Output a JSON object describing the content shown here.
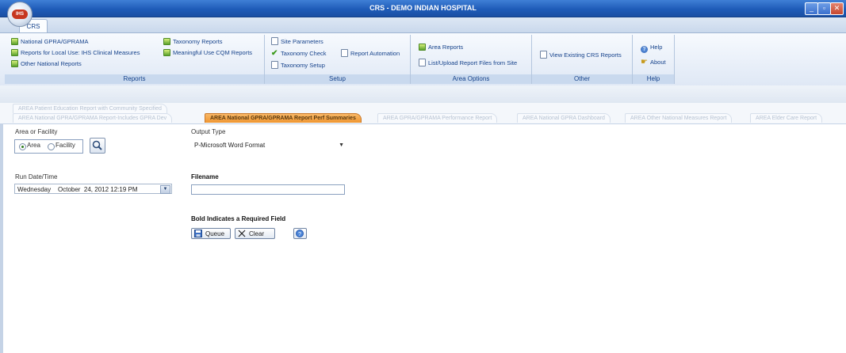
{
  "window": {
    "title": "CRS - DEMO INDIAN HOSPITAL",
    "orb_text": "IHS"
  },
  "ribbon_tab": "CRS",
  "ribbon": {
    "reports": {
      "label": "Reports",
      "items": [
        "National GPRA/GPRAMA",
        "Reports for Local Use: IHS Clinical Measures",
        "Other National Reports",
        "Taxonomy Reports",
        "Meaningful Use CQM Reports"
      ]
    },
    "setup": {
      "label": "Setup",
      "items": [
        "Site Parameters",
        "Taxonomy Check",
        "Report Automation",
        "Taxonomy Setup"
      ]
    },
    "area_options": {
      "label": "Area Options",
      "items": [
        "Area Reports",
        "List/Upload Report Files from Site"
      ]
    },
    "other": {
      "label": "Other",
      "items": [
        "View Existing CRS Reports"
      ]
    },
    "help": {
      "label": "Help",
      "items": [
        "Help",
        "About"
      ]
    }
  },
  "doc_tabs": {
    "row1": [
      "AREA Patient Education Report with Community Specified"
    ],
    "row2": [
      "AREA National GPRA/GPRAMA Report-Includes GPRA Dev",
      "AREA National GPRA/GPRAMA Report Perf Summaries",
      "AREA GPRA/GPRAMA Performance Report",
      "AREA National GPRA Dashboard",
      "AREA Other National Measures Report",
      "AREA Elder Care Report"
    ],
    "active": "AREA National GPRA/GPRAMA Report Perf Summaries"
  },
  "form": {
    "area_facility_label": "Area or Facility",
    "radio_area": "Area",
    "radio_facility": "Facility",
    "selected_radio": "Area",
    "output_type_label": "Output Type",
    "output_type_value": "P-Microsoft Word Format",
    "run_datetime_label": "Run Date/Time",
    "run_datetime_value": "Wednesday    October  24, 2012 12:19 PM",
    "filename_label": "Filename",
    "filename_value": "",
    "required_note": "Bold Indicates a Required Field",
    "queue_button": "Queue",
    "clear_button": "Clear"
  },
  "colors": {
    "title_bar": "#1f5cb8",
    "active_tab": "#ef9531",
    "ribbon_text": "#15428b"
  }
}
